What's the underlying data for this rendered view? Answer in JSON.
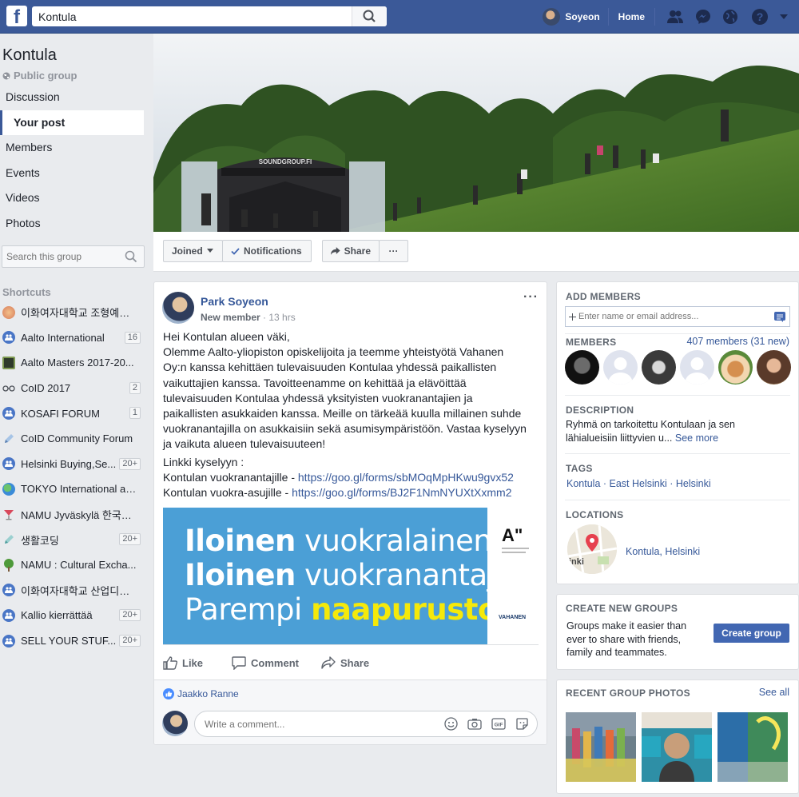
{
  "topbar": {
    "search_value": "Kontula",
    "user_name": "Soyeon",
    "home_label": "Home",
    "icons": [
      "facebook-logo-icon",
      "search-icon",
      "friend-requests-icon",
      "messenger-icon",
      "notifications-globe-icon",
      "help-icon",
      "dropdown-caret-icon"
    ]
  },
  "group": {
    "name": "Kontula",
    "privacy": "Public group"
  },
  "left_nav": [
    "Discussion",
    "Your post",
    "Members",
    "Events",
    "Videos",
    "Photos"
  ],
  "left_nav_active": "Your post",
  "group_search_placeholder": "Search this group",
  "shortcuts": {
    "heading": "Shortcuts",
    "items": [
      {
        "label": "이화여자대학교 조형예술대학",
        "badge": "",
        "icon": "group-photo-icon"
      },
      {
        "label": "Aalto International",
        "badge": "16",
        "icon": "group-icon"
      },
      {
        "label": "Aalto Masters 2017-20...",
        "badge": "",
        "icon": "group-photo-icon"
      },
      {
        "label": "CoID 2017",
        "badge": "2",
        "icon": "glasses-icon"
      },
      {
        "label": "KOSAFI FORUM",
        "badge": "1",
        "icon": "group-icon"
      },
      {
        "label": "CoID Community Forum",
        "badge": "",
        "icon": "pencil-icon"
      },
      {
        "label": "Helsinki Buying,Se...",
        "badge": "20+",
        "icon": "group-icon"
      },
      {
        "label": "TOKYO International af...",
        "badge": "",
        "icon": "globe-icon"
      },
      {
        "label": "NAMU Jyväskylä 한국인...",
        "badge": "",
        "icon": "cocktail-icon"
      },
      {
        "label": "생활코딩",
        "badge": "20+",
        "icon": "pencil-icon"
      },
      {
        "label": "NAMU : Cultural Excha...",
        "badge": "",
        "icon": "tree-icon"
      },
      {
        "label": "이화여자대학교 산업디자인",
        "badge": "",
        "icon": "group-icon"
      },
      {
        "label": "Kallio kierrättää",
        "badge": "20+",
        "icon": "group-icon"
      },
      {
        "label": "SELL YOUR STUF...",
        "badge": "20+",
        "icon": "group-icon"
      }
    ]
  },
  "action_bar": {
    "joined": "Joined",
    "notifications": "Notifications",
    "share": "Share",
    "more": "···"
  },
  "post": {
    "author": "Park Soyeon",
    "role": "New member",
    "time": "13 hrs",
    "body": [
      "Hei Kontulan alueen väki,",
      "Olemme Aalto-yliopiston opiskelijoita ja teemme yhteistyötä Vahanen",
      "Oy:n kanssa kehittäen tulevaisuuden Kontulaa yhdessä paikallisten",
      "vaikuttajien kanssa. Tavoitteenamme on kehittää ja elävöittää",
      "tulevaisuuden Kontulaa yhdessä yksityisten vuokranantajien ja",
      "paikallisten asukkaiden kanssa. Meille on tärkeää kuulla millainen suhde",
      "vuokranantajilla on asukkaisiin sekä asumisympäristöön. Vastaa kyselyyn",
      "ja vaikuta alueen tulevaisuuteen!"
    ],
    "links_intro": "Linkki kyselyyn :",
    "link1_label": "Kontulan vuokranantajille - ",
    "link1_url": "https://goo.gl/forms/sbMOqMpHKwu9gvx52",
    "link2_label": "Kontulan vuokra-asujille - ",
    "link2_url": "https://goo.gl/forms/BJ2F1NmNYUXtXxmm2",
    "banner": {
      "line1_bold": "Iloinen",
      "line1_rest": " vuokralainen.",
      "line2_bold": "Iloinen",
      "line2_rest": " vuokranantaja.",
      "line3_rest": "Parempi ",
      "line3_highlight": "naapurusto!",
      "logo_text": "A\"",
      "brand": "VAHANEN"
    },
    "actions": {
      "like": "Like",
      "comment": "Comment",
      "share": "Share"
    },
    "liker": "Jaakko Ranne",
    "comment_placeholder": "Write a comment..."
  },
  "right": {
    "add_members": {
      "heading": "ADD MEMBERS",
      "placeholder": "Enter name or email address..."
    },
    "members": {
      "heading": "MEMBERS",
      "count": "407 members (31 new)"
    },
    "description": {
      "heading": "DESCRIPTION",
      "text": "Ryhmä on tarkoitettu Kontulaan ja sen lähialueisiin liittyvien u... ",
      "see_more": "See more"
    },
    "tags": {
      "heading": "TAGS",
      "items": [
        "Kontula",
        "East Helsinki",
        "Helsinki"
      ],
      "separator": " · "
    },
    "locations": {
      "heading": "LOCATIONS",
      "place": "Kontula",
      "city": "Helsinki",
      "map_text": "inki"
    },
    "create_groups": {
      "heading": "CREATE NEW GROUPS",
      "text": "Groups make it easier than ever to share with friends, family and teammates.",
      "button": "Create group"
    },
    "recent_photos": {
      "heading": "RECENT GROUP PHOTOS",
      "see_all": "See all"
    }
  },
  "colors": {
    "brand": "#3b5998",
    "link": "#365899",
    "button_blue": "#4267b2",
    "banner_blue": "#4b9fd6",
    "banner_highlight": "#f5e90a"
  }
}
